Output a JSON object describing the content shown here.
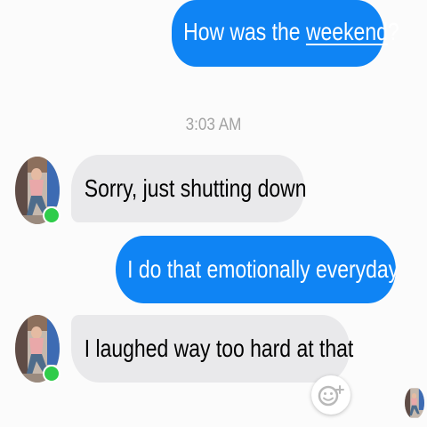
{
  "messages": [
    {
      "direction": "outgoing",
      "text_before": "How was the ",
      "linked_word": "weekend",
      "text_after": "?"
    },
    {
      "direction": "incoming",
      "text": "Sorry, just shutting down",
      "sender_online": true
    },
    {
      "direction": "outgoing",
      "text": "I do that emotionally everyday"
    },
    {
      "direction": "incoming",
      "text": "I laughed way too hard at that",
      "sender_online": true
    }
  ],
  "timestamp": "3:03 AM",
  "colors": {
    "outgoing_bubble": "#0f84f4",
    "incoming_bubble": "#e9e9eb",
    "online_indicator": "#2fcc4a",
    "timestamp_text": "#a2a2a2"
  },
  "icons": {
    "emoji_reaction": "smiley-plus-icon",
    "seen_indicator": "seen-avatar-icon"
  }
}
